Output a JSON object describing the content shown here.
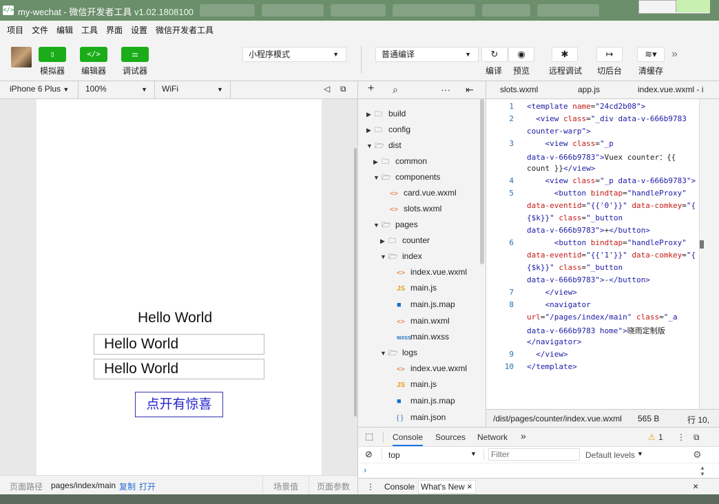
{
  "titlebar": {
    "title": "my-wechat - 微信开发者工具 ",
    "version": "v1.02.1808100"
  },
  "menu": [
    "项目",
    "文件",
    "编辑",
    "工具",
    "界面",
    "设置",
    "微信开发者工具"
  ],
  "toolbar": {
    "simulator_label": "模拟器",
    "editor_label": "编辑器",
    "debugger_label": "调试器",
    "mode_select": "小程序模式",
    "compile_select": "普通编译",
    "compile_label": "编译",
    "preview_label": "预览",
    "remote_debug_label": "远程调试",
    "background_label": "切后台",
    "clear_cache_label": "清缓存",
    "more": "»"
  },
  "simulator": {
    "device": "iPhone 6 Plus",
    "zoom": "100%",
    "network": "WiFi",
    "content": {
      "hello1": "Hello World",
      "hello2": "Hello World",
      "hello3": "Hello World",
      "navigator_text": "点开有惊喜"
    },
    "status": {
      "path_label": "页面路径",
      "path": "pages/index/main",
      "copy": "复制",
      "open": "打开",
      "scene": "场景值",
      "params": "页面参数"
    }
  },
  "tree": {
    "items": [
      {
        "label": "build",
        "type": "folder",
        "expanded": false
      },
      {
        "label": "config",
        "type": "folder",
        "expanded": false
      },
      {
        "label": "dist",
        "type": "folder",
        "expanded": true
      },
      {
        "label": "common",
        "type": "folder",
        "expanded": false
      },
      {
        "label": "components",
        "type": "folder",
        "expanded": true
      },
      {
        "label": "card.vue.wxml",
        "type": "wxml"
      },
      {
        "label": "slots.wxml",
        "type": "wxml"
      },
      {
        "label": "pages",
        "type": "folder",
        "expanded": true
      },
      {
        "label": "counter",
        "type": "folder",
        "expanded": false
      },
      {
        "label": "index",
        "type": "folder",
        "expanded": true
      },
      {
        "label": "index.vue.wxml",
        "type": "wxml"
      },
      {
        "label": "main.js",
        "type": "js"
      },
      {
        "label": "main.js.map",
        "type": "map"
      },
      {
        "label": "main.wxml",
        "type": "wxml"
      },
      {
        "label": "main.wxss",
        "type": "wxss"
      },
      {
        "label": "logs",
        "type": "folder",
        "expanded": true
      },
      {
        "label": "index.vue.wxml",
        "type": "wxml"
      },
      {
        "label": "main.js",
        "type": "js"
      },
      {
        "label": "main.js.map",
        "type": "map"
      },
      {
        "label": "main.json",
        "type": "json"
      }
    ]
  },
  "editor": {
    "tabs": [
      "slots.wxml",
      "app.js",
      "index.vue.wxml - i"
    ],
    "status_path": "/dist/pages/counter/index.vue.wxml",
    "status_size": "565 B",
    "status_line": "行 10,"
  },
  "devtools": {
    "tabs": [
      "Console",
      "Sources",
      "Network"
    ],
    "more": "»",
    "warnings": "1",
    "context": "top",
    "filter_placeholder": "Filter",
    "levels": "Default levels",
    "prompt": "›",
    "drawer_tabs": [
      "Console",
      "What's New"
    ],
    "close": "×"
  }
}
